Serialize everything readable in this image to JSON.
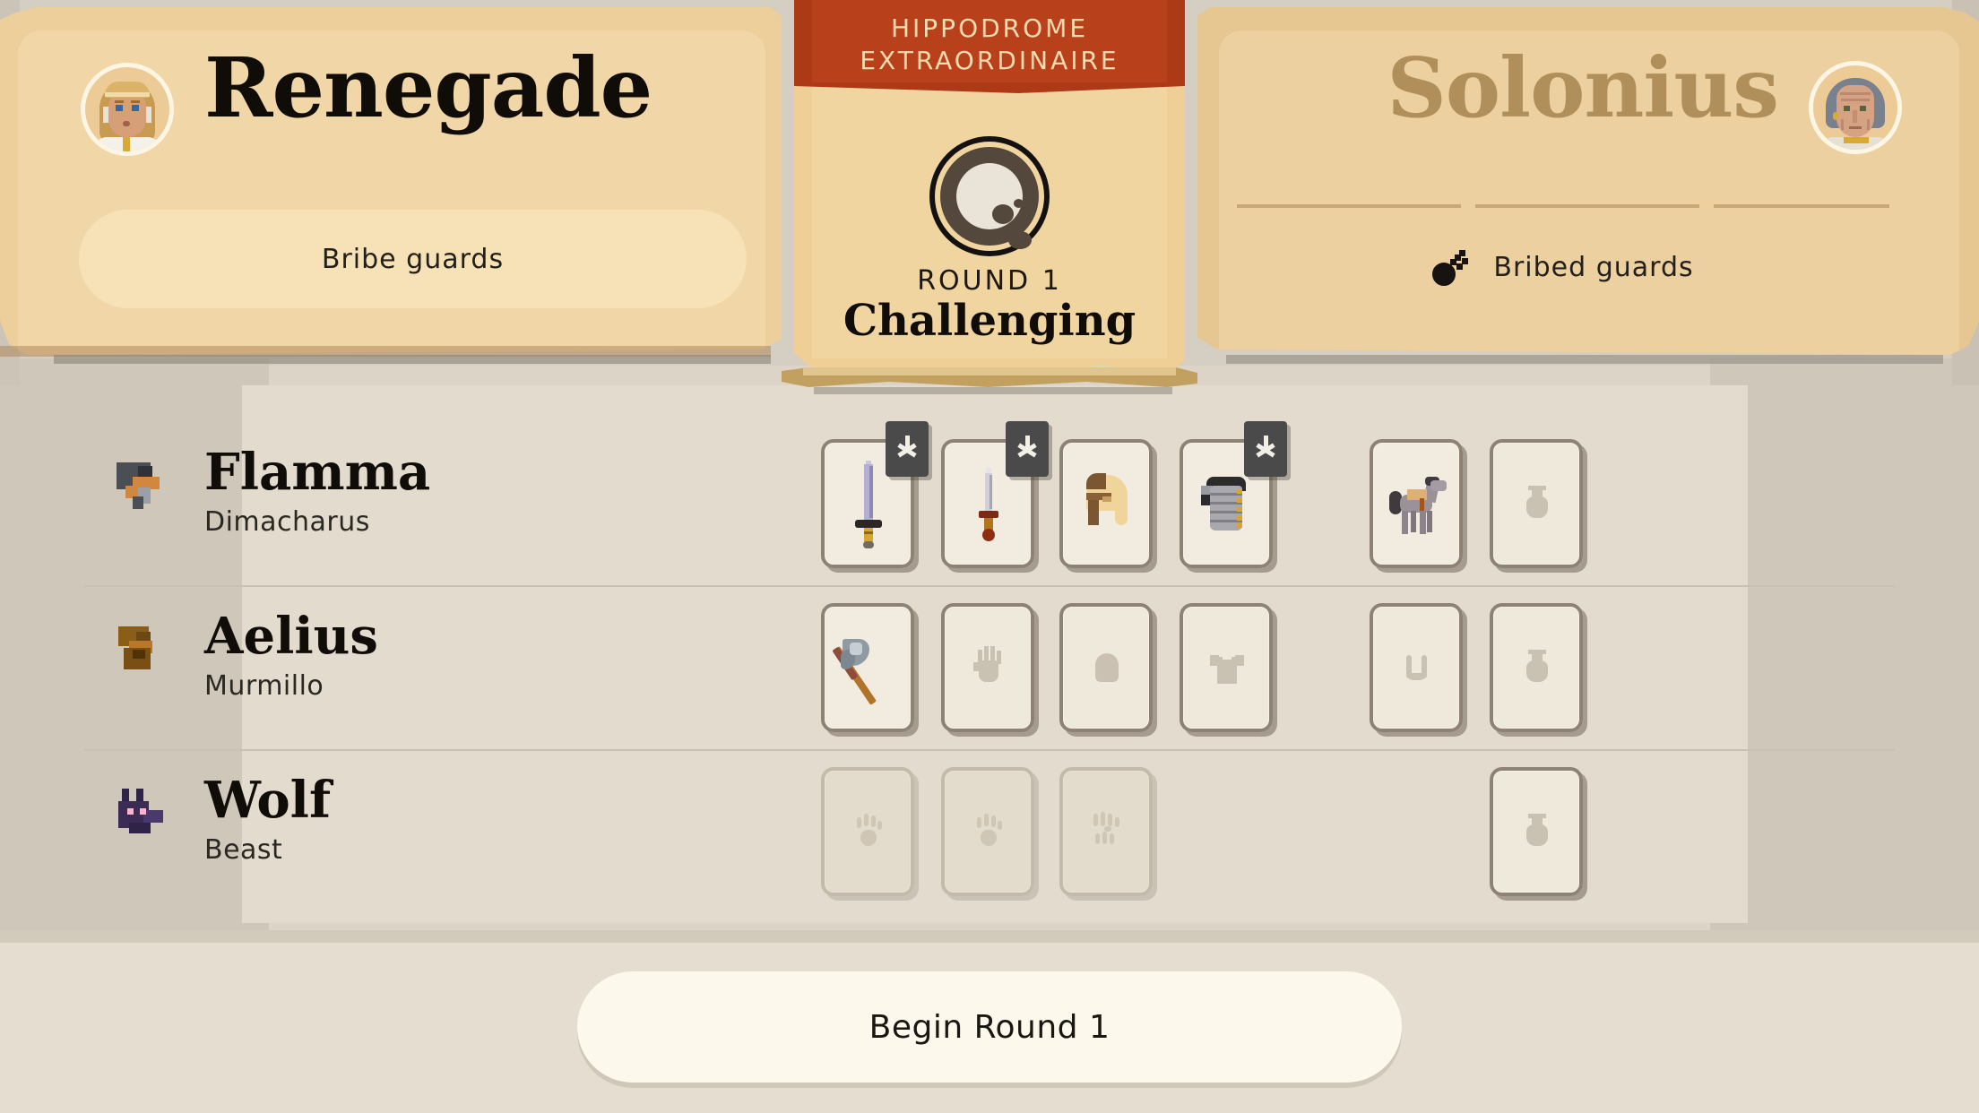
{
  "header": {
    "player": {
      "name": "Renegade",
      "avatar_icon": "player-portrait-female",
      "action_label": "Bribe guards"
    },
    "opponent": {
      "name": "Solonius",
      "avatar_icon": "opponent-portrait-elder",
      "status_icon": "key-coin-icon",
      "status_label": "Bribed guards"
    }
  },
  "center_banner": {
    "event_line1": "HIPPODROME",
    "event_line2": "EXTRAORDINAIRE",
    "emblem_icon": "moon-seal-emblem",
    "round_label": "ROUND 1",
    "difficulty": "Challenging"
  },
  "roster": {
    "fighters": [
      {
        "name": "Flamma",
        "class": "Dimacharus",
        "avatar_icon": "gladiator-flamma-icon",
        "slots": [
          {
            "name": "weapon-primary",
            "icon": "long-sword-icon",
            "state": "filled",
            "badge": "new-item-star"
          },
          {
            "name": "weapon-offhand",
            "icon": "dagger-icon",
            "state": "filled",
            "badge": "new-item-star"
          },
          {
            "name": "head",
            "icon": "roman-helmet-icon",
            "state": "filled",
            "badge": null
          },
          {
            "name": "body",
            "icon": "lorica-armor-icon",
            "state": "filled",
            "badge": "new-item-star"
          },
          {
            "name": "mount",
            "icon": "horse-icon",
            "state": "filled",
            "badge": null
          },
          {
            "name": "consumable",
            "icon": "potion-placeholder",
            "state": "empty",
            "badge": null
          }
        ]
      },
      {
        "name": "Aelius",
        "class": "Murmillo",
        "avatar_icon": "gladiator-aelius-icon",
        "slots": [
          {
            "name": "weapon-primary",
            "icon": "axe-icon",
            "state": "filled",
            "badge": null
          },
          {
            "name": "weapon-offhand",
            "icon": "hand-placeholder",
            "state": "empty",
            "badge": null
          },
          {
            "name": "head",
            "icon": "helmet-placeholder",
            "state": "empty",
            "badge": null
          },
          {
            "name": "body",
            "icon": "shirt-placeholder",
            "state": "empty",
            "badge": null
          },
          {
            "name": "mount",
            "icon": "horseshoe-placeholder",
            "state": "empty",
            "badge": null
          },
          {
            "name": "consumable",
            "icon": "potion-placeholder",
            "state": "empty",
            "badge": null
          }
        ]
      },
      {
        "name": "Wolf",
        "class": "Beast",
        "avatar_icon": "wolf-head-icon",
        "slots": [
          {
            "name": "weapon-primary",
            "icon": "paw-placeholder",
            "state": "disabled",
            "badge": null
          },
          {
            "name": "weapon-offhand",
            "icon": "paw-placeholder",
            "state": "disabled",
            "badge": null
          },
          {
            "name": "head",
            "icon": "paws-placeholder",
            "state": "disabled",
            "badge": null
          },
          {
            "name": "consumable",
            "icon": "potion-placeholder",
            "state": "empty",
            "badge": null
          }
        ]
      }
    ]
  },
  "footer": {
    "begin_label": "Begin Round 1"
  },
  "colors": {
    "banner_red": "#b8401b",
    "scroll_tan": "#f1d5a0",
    "page_bg": "#dcd5c7",
    "text_dark": "#100d09",
    "opponent_name": "#b08f5b"
  }
}
